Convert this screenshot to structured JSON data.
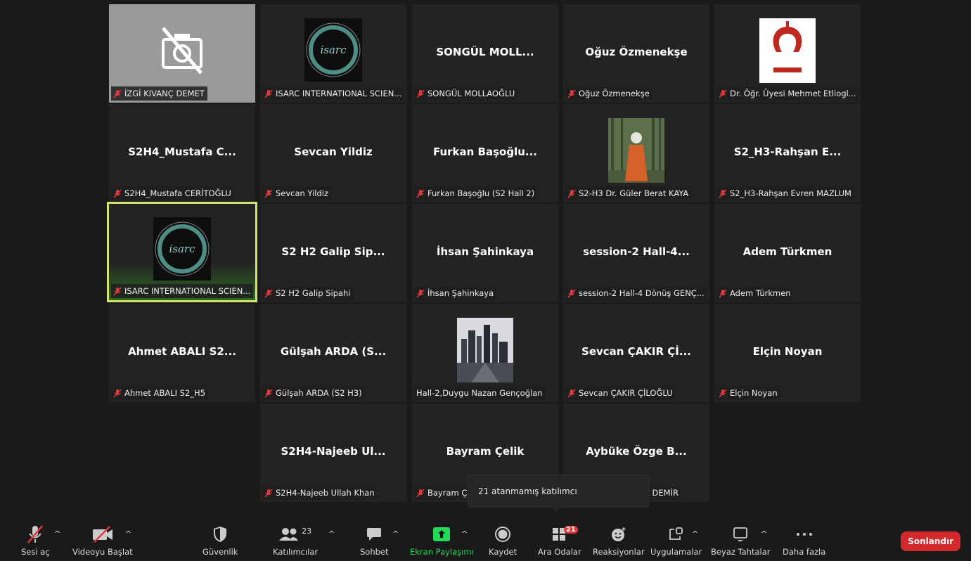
{
  "tiles": [
    {
      "label": "İZGİ KIVANÇ DEMET",
      "center": "",
      "kind": "camoff"
    },
    {
      "label": "ISARC INTERNATIONAL SCIEN...",
      "center": "",
      "kind": "logo"
    },
    {
      "label": "SONGÜL MOLLAOĞLU",
      "center": "SONGÜL  MOLL...",
      "kind": "name"
    },
    {
      "label": "Oğuz Özmenekşe",
      "center": "Oğuz Özmenekşe",
      "kind": "name"
    },
    {
      "label": "Dr. Öğr. Üyesi Mehmet Etliogl...",
      "center": "",
      "kind": "unilogo"
    },
    {
      "label": "S2H4_Mustafa CERİTOĞLU",
      "center": "S2H4_Mustafa  C...",
      "kind": "name"
    },
    {
      "label": "Sevcan Yildiz",
      "center": "Sevcan Yildiz",
      "kind": "name"
    },
    {
      "label": "Furkan Başoğlu (S2 Hall 2)",
      "center": "Furkan  Başoğlu...",
      "kind": "name"
    },
    {
      "label": "S2-H3 Dr. Güler Berat KAYA",
      "center": "",
      "kind": "photo"
    },
    {
      "label": "S2_H3-Rahşan Evren MAZLUM",
      "center": "S2_H3-Rahşan  E...",
      "kind": "name"
    },
    {
      "label": "ISARC INTERNATIONAL SCIEN...",
      "center": "",
      "kind": "logo"
    },
    {
      "label": "S2 H2 Galip Sipahi",
      "center": "S2  H2  Galip  Sip...",
      "kind": "name"
    },
    {
      "label": "İhsan Şahinkaya",
      "center": "İhsan Şahinkaya",
      "kind": "name"
    },
    {
      "label": "session-2 Hall-4 Dönüş GENÇ...",
      "center": "session-2  Hall-4...",
      "kind": "name"
    },
    {
      "label": "Adem Türkmen",
      "center": "Adem Türkmen",
      "kind": "name"
    },
    {
      "label": "Ahmet ABALI S2_H5",
      "center": "Ahmet ABALI S2...",
      "kind": "name"
    },
    {
      "label": "Gülşah ARDA (S2 H3)",
      "center": "Gülşah ARDA (S...",
      "kind": "name"
    },
    {
      "label": "Hall-2,Duygu  Nazan Gençoğlan",
      "center": "",
      "kind": "city"
    },
    {
      "label": "Sevcan ÇAKIR ÇİLOĞLU",
      "center": "Sevcan ÇAKIR Çİ...",
      "kind": "name"
    },
    {
      "label": "Elçin Noyan",
      "center": "Elçin Noyan",
      "kind": "name"
    },
    {
      "label": "S2H4-Najeeb Ullah Khan",
      "center": "S2H4-Najeeb  Ul...",
      "kind": "name"
    },
    {
      "label": "Bayram Ç",
      "center": "Bayram Çelik",
      "kind": "name"
    },
    {
      "label": "Z DEMİR",
      "center": "Aybüke Özge B...",
      "kind": "name"
    }
  ],
  "tooltip": "21 atanmamış katılımcı",
  "toolbar": {
    "mute": "Sesi aç",
    "video": "Videoyu Başlat",
    "security": "Güvenlik",
    "participants": "Katılımcılar",
    "participants_count": "23",
    "chat": "Sohbet",
    "share": "Ekran Paylaşımı",
    "record": "Kaydet",
    "breakout": "Ara Odalar",
    "breakout_badge": "21",
    "reactions": "Reaksiyonlar",
    "apps": "Uygulamalar",
    "whiteboards": "Beyaz Tahtalar",
    "more": "Daha fazla",
    "end": "Sonlandır"
  },
  "colors": {
    "active_border": "#d4e46b",
    "share_green": "#23d959",
    "end_red": "#d5282d",
    "mic_red": "#e0393e"
  }
}
